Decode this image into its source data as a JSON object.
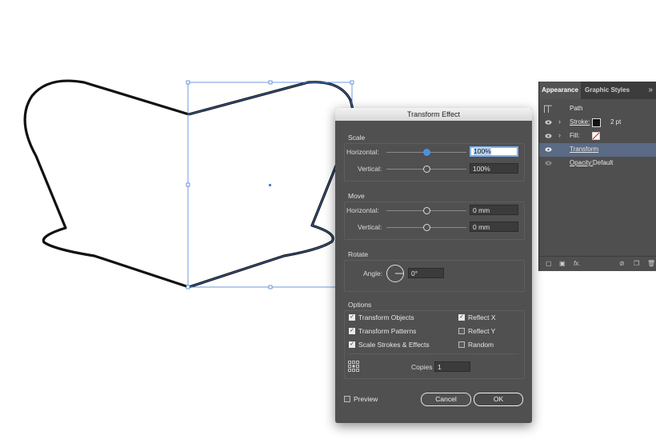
{
  "appearance_panel": {
    "tabs": [
      "Appearance",
      "Graphic Styles"
    ],
    "menu_icon": "double-chevron-icon",
    "rows": [
      {
        "label": "Path",
        "value": ""
      },
      {
        "label": "Stroke:",
        "value": "2 pt"
      },
      {
        "label": "Fill:",
        "value": ""
      },
      {
        "label": "Transform",
        "value": ""
      },
      {
        "label": "Opacity:",
        "value": "Default"
      }
    ],
    "fx_label": "fx."
  },
  "dialog": {
    "title": "Transform Effect",
    "scale": {
      "section": "Scale",
      "horizontal_label": "Horizontal:",
      "horizontal_value": "100%",
      "vertical_label": "Vertical:",
      "vertical_value": "100%"
    },
    "move": {
      "section": "Move",
      "horizontal_label": "Horizontal:",
      "horizontal_value": "0 mm",
      "vertical_label": "Vertical:",
      "vertical_value": "0 mm"
    },
    "rotate": {
      "section": "Rotate",
      "angle_label": "Angle:",
      "angle_value": "0°"
    },
    "options": {
      "section": "Options",
      "transform_objects": "Transform Objects",
      "transform_patterns": "Transform Patterns",
      "scale_strokes": "Scale Strokes & Effects",
      "reflect_x": "Reflect X",
      "reflect_y": "Reflect Y",
      "random": "Random",
      "copies_label": "Copies",
      "copies_value": "1"
    },
    "preview_label": "Preview",
    "cancel_label": "Cancel",
    "ok_label": "OK",
    "checks": {
      "transform_objects": true,
      "transform_patterns": true,
      "scale_strokes": true,
      "reflect_x": true,
      "reflect_y": false,
      "random": false,
      "preview": false
    }
  },
  "colors": {
    "selection": "#4a7fd4",
    "panel_bg": "#4f4f4f",
    "dialog_bg": "#505050",
    "accent": "#4a90e2"
  }
}
